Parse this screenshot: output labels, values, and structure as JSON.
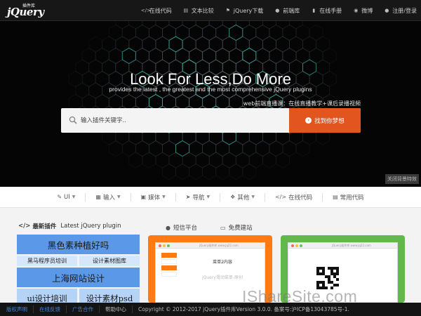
{
  "logo": {
    "main": "jQuery",
    "sub": "插件库"
  },
  "nav": [
    {
      "icon": "code-icon",
      "glyph": "</>",
      "label": "在线代码"
    },
    {
      "icon": "document-icon",
      "glyph": "▤",
      "label": "文本比较"
    },
    {
      "icon": "flag-icon",
      "glyph": "⚑",
      "label": "jQuery下载"
    },
    {
      "icon": "user-icon",
      "glyph": "●",
      "label": "前端库"
    },
    {
      "icon": "book-icon",
      "glyph": "▮",
      "label": "在线手册"
    },
    {
      "icon": "weibo-icon",
      "glyph": "◉",
      "label": "微博"
    },
    {
      "icon": "user-icon",
      "glyph": "●",
      "label": "注册/登录"
    }
  ],
  "hero": {
    "title": "Look For Less,Do More",
    "subtitle": "provides the latest , the greatest and the most comprehensive jQuery plugins",
    "promo": "web前端直播课：在线直播教学+课后录播视频",
    "search_placeholder": "输入插件关键字..",
    "search_button": "找到你梦想",
    "bg_toggle": "关闭背景特效"
  },
  "categories": [
    {
      "icon": "brush-icon",
      "glyph": "✎",
      "label": "UI",
      "dropdown": true
    },
    {
      "icon": "keyboard-icon",
      "glyph": "▦",
      "label": "输入",
      "dropdown": true
    },
    {
      "icon": "film-icon",
      "glyph": "▣",
      "label": "媒体",
      "dropdown": true
    },
    {
      "icon": "send-icon",
      "glyph": "➤",
      "label": "导航",
      "dropdown": true
    },
    {
      "icon": "dropbox-icon",
      "glyph": "❖",
      "label": "其他",
      "dropdown": true
    },
    {
      "icon": "code-icon",
      "glyph": "</>",
      "label": "在线代码",
      "dropdown": false
    },
    {
      "icon": "document-icon",
      "glyph": "▤",
      "label": "常用代码",
      "dropdown": false
    }
  ],
  "section": {
    "title": "最新插件",
    "subtitle": "Latest  jQuery  plugin"
  },
  "ads": {
    "row1": "黑色素种植好吗",
    "row2a": "黑马程序员培训",
    "row2b": "设计素材图库",
    "row3": "上海网站设计",
    "row4a": "ui设计培训",
    "row4b": "设计素材psd"
  },
  "mid": {
    "sms": "短信平台",
    "build": "免费建站"
  },
  "card1": {
    "url": "jQuery插件库 www.jq22.com",
    "content_title": "菜单2内容",
    "content_sub": "jQuery滑动菜单-原创"
  },
  "card2": {
    "url": "jQuery插件库 www.jq22.com"
  },
  "watermark": "IShareSite.com",
  "footer": {
    "links": [
      "版权声明",
      "在线反馈",
      "广告合作",
      "帮助中心"
    ],
    "copyright": "Copyright © 2012-2017 jQuery插件库Version 3.0.0. 备案号:沪ICP备13043785号-1."
  },
  "colors": {
    "accent": "#e2551f",
    "ad_blue": "#5b99e8",
    "card_orange": "#ff7a12",
    "card_green": "#63b84b",
    "link": "#3f86d9"
  }
}
